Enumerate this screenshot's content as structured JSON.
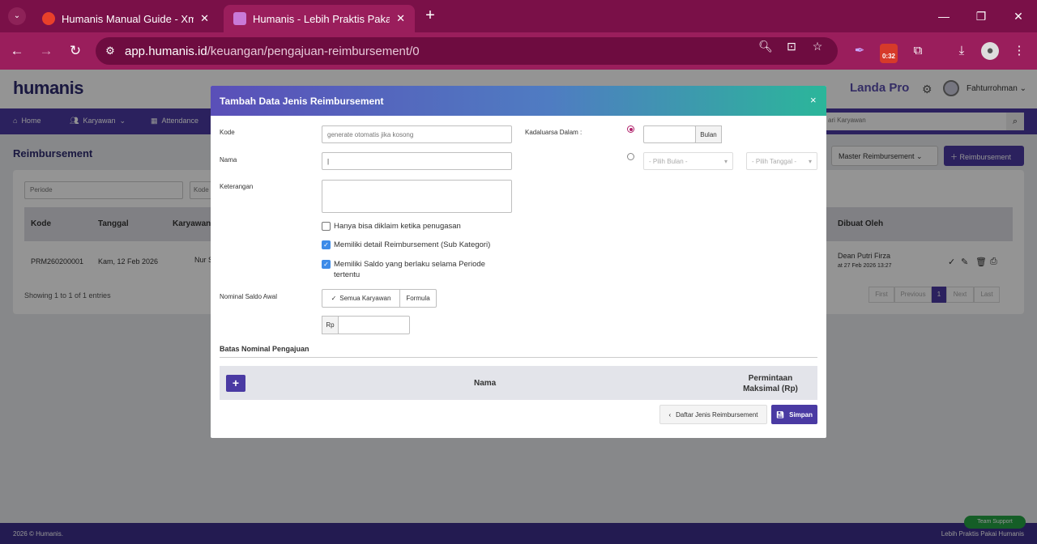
{
  "browser": {
    "tabs": [
      {
        "title": "Humanis Manual Guide - Xmind",
        "active": false
      },
      {
        "title": "Humanis - Lebih Praktis Pakai Humanis",
        "active": true
      }
    ],
    "url_host": "app.humanis.id",
    "url_path": "/keuangan/pengajuan-reimbursement/0",
    "extension_badge": "0:32"
  },
  "app": {
    "logo": "humanis",
    "company": "Landa Pro",
    "user": "Fahturrohman",
    "nav": [
      "Home",
      "Karyawan",
      "Attendance"
    ],
    "search_placeholder": "ari Karyawan",
    "page_title": "Reimbursement",
    "master_button": "Master Reimbursement",
    "add_button": "Reimbursement",
    "filters": {
      "periode": "Periode",
      "kode": "Kode"
    },
    "table_headers": [
      "Kode",
      "Tanggal",
      "Karyawan",
      "Dibuat Oleh"
    ],
    "row": {
      "kode": "PRM260200001",
      "tanggal": "Kam, 12 Feb 2026",
      "karyawan": "Nur S",
      "dibuat_oleh": "Dean Putri Firza",
      "dibuat_at": "at 27 Feb 2026 13:27"
    },
    "showing": "Showing 1 to 1 of 1 entries",
    "pager": [
      "First",
      "Previous",
      "1",
      "Next",
      "Last"
    ],
    "footer_left": "2026 © Humanis.",
    "footer_right": "Lebih Praktis Pakai Humanis",
    "support": "Team Support"
  },
  "modal": {
    "title": "Tambah Data Jenis Reimbursement",
    "labels": {
      "kode": "Kode",
      "nama": "Nama",
      "keterangan": "Keterangan",
      "kadaluarsa": "Kadaluarsa Dalam :",
      "nominal": "Nominal Saldo Awal"
    },
    "kode_placeholder": "generate otomatis jika kosong",
    "bulan_addon": "Bulan",
    "pilih_bulan": "- Pilih Bulan -",
    "pilih_tanggal": "- Pilih Tanggal -",
    "checkboxes": [
      {
        "label": "Hanya bisa diklaim ketika penugasan",
        "checked": false
      },
      {
        "label": "Memiliki detail Reimbursement (Sub Kategori)",
        "checked": true
      },
      {
        "label": "Memiliki Saldo yang berlaku selama Periode tertentu",
        "checked": true
      }
    ],
    "saldo_options": [
      "Semua Karyawan",
      "Formula"
    ],
    "rp_prefix": "Rp",
    "batas_title": "Batas Nominal Pengajuan",
    "batas_columns": {
      "nama": "Nama",
      "max": "Permintaan Maksimal (Rp)"
    },
    "btn_daftar": "Daftar Jenis Reimbursement",
    "btn_simpan": "Simpan"
  }
}
